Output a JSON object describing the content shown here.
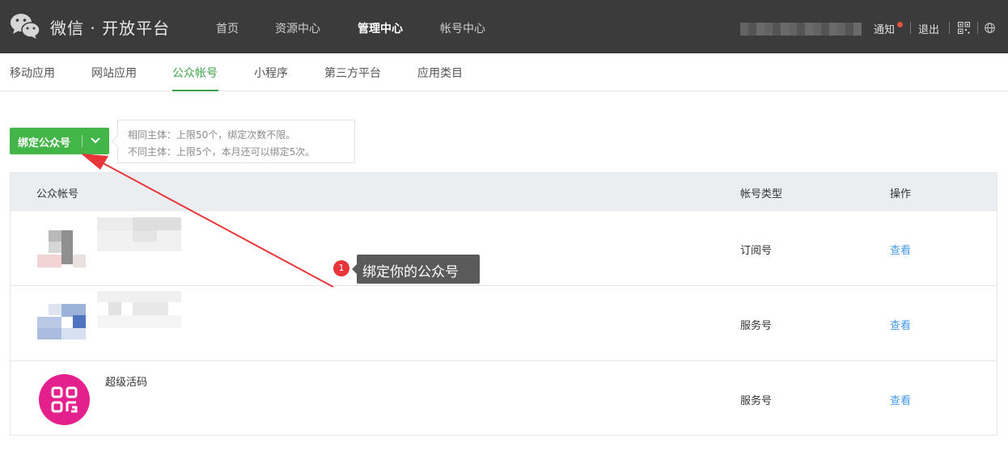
{
  "brand": {
    "title": "微信 · 开放平台"
  },
  "top_nav": [
    {
      "label": "首页"
    },
    {
      "label": "资源中心"
    },
    {
      "label": "管理中心",
      "active": true
    },
    {
      "label": "帐号中心"
    }
  ],
  "top_right": {
    "notify": "通知",
    "logout": "退出"
  },
  "sub_tabs": [
    {
      "label": "移动应用"
    },
    {
      "label": "网站应用"
    },
    {
      "label": "公众帐号",
      "active": true
    },
    {
      "label": "小程序"
    },
    {
      "label": "第三方平台"
    },
    {
      "label": "应用类目"
    }
  ],
  "bind_button": {
    "label": "绑定公众号"
  },
  "bind_info": {
    "line1": "相同主体：上限50个，绑定次数不限。",
    "line2": "不同主体：上限5个，本月还可以绑定5次。"
  },
  "table": {
    "headers": {
      "account": "公众帐号",
      "type": "帐号类型",
      "action": "操作"
    },
    "rows": [
      {
        "name": "",
        "type": "订阅号",
        "action": "查看"
      },
      {
        "name": "",
        "type": "服务号",
        "action": "查看"
      },
      {
        "name": "超级活码",
        "type": "服务号",
        "action": "查看"
      }
    ]
  },
  "annotation": {
    "badge": "1",
    "text": "绑定你的公众号"
  },
  "colors": {
    "topbar": "#3b3b3b",
    "accent_green": "#44b549",
    "link_blue": "#459ae9",
    "avatar_pink": "#e4208c",
    "badge_red": "#e8353a"
  },
  "icons": [
    "wechat-logo-icon",
    "chevron-down-icon",
    "qr-code-icon",
    "globe-icon",
    "notification-dot-icon"
  ]
}
